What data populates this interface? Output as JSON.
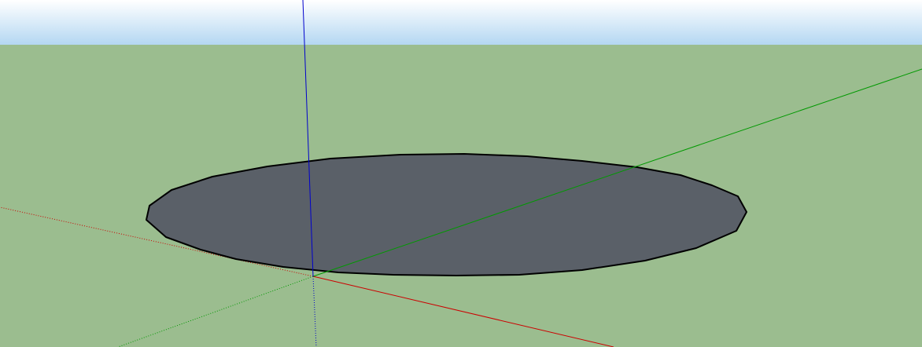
{
  "viewport": {
    "sky_color_top": "#ffffff",
    "sky_color_bottom": "#b4d7f2",
    "ground_color": "#9bbd8f"
  },
  "model": {
    "shape": "circle-face",
    "face_color": "#5a6068",
    "edge_color": "#000000"
  },
  "axes": {
    "red_color": "#cc0000",
    "green_color": "#009900",
    "blue_color": "#0000cc"
  }
}
